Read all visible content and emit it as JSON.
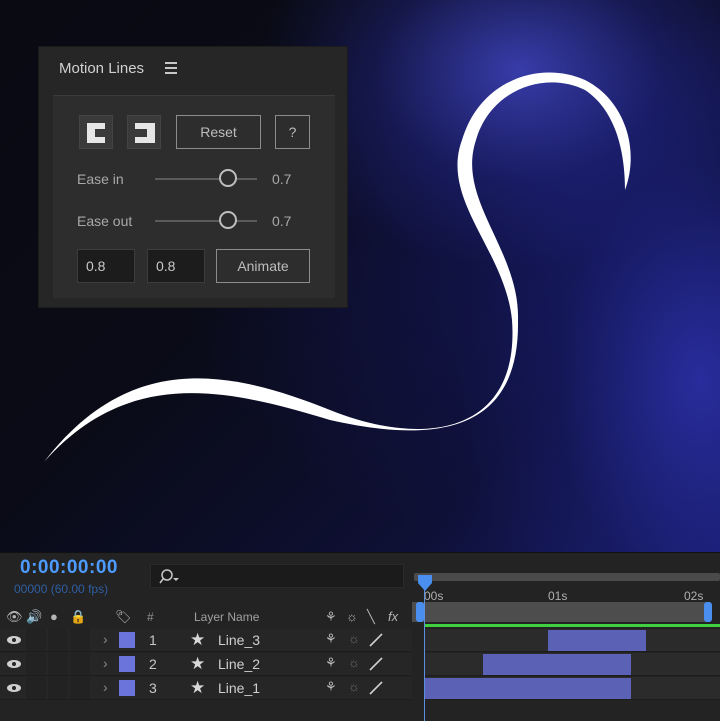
{
  "panel": {
    "title": "Motion Lines",
    "reset_label": "Reset",
    "help_label": "?",
    "ease_in_label": "Ease in",
    "ease_in_value": "0.7",
    "ease_out_label": "Ease out",
    "ease_out_value": "0.7",
    "field1_value": "0.8",
    "field2_value": "0.8",
    "animate_label": "Animate"
  },
  "timeline": {
    "timecode": "0:00:00:00",
    "frames": "00000 (60.00 fps)",
    "col_number": "#",
    "col_layer_name": "Layer Name",
    "ruler": [
      "00s",
      "01s",
      "02s"
    ],
    "layers": [
      {
        "num": "1",
        "name": "Line_3",
        "clip_start": 0.42,
        "clip_end": 0.75
      },
      {
        "num": "2",
        "name": "Line_2",
        "clip_start": 0.2,
        "clip_end": 0.7
      },
      {
        "num": "3",
        "name": "Line_1",
        "clip_start": 0.0,
        "clip_end": 0.7
      }
    ]
  },
  "colors": {
    "timecode": "#4d9bff",
    "label_swatch": "#6b74db",
    "clip": "#5b61b4",
    "green_bar": "#3fd13f"
  }
}
